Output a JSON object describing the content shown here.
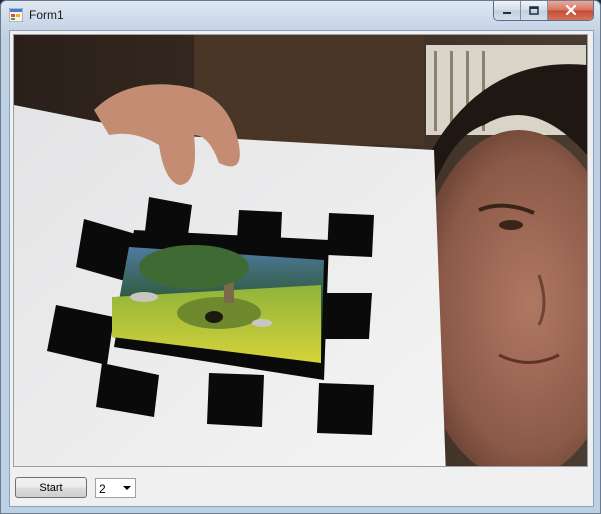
{
  "window": {
    "title": "Form1",
    "icons": {
      "app": "form-app-icon",
      "minimize": "minimize-icon",
      "maximize": "maximize-icon",
      "close": "close-icon"
    }
  },
  "controls": {
    "start_label": "Start",
    "combo_value": "2"
  },
  "colors": {
    "window_frame": "#c9d7e8",
    "client_bg": "#f0f0f0",
    "close_button": "#c54b33",
    "marker": "#0a0a0a",
    "paper": "#efefef"
  }
}
